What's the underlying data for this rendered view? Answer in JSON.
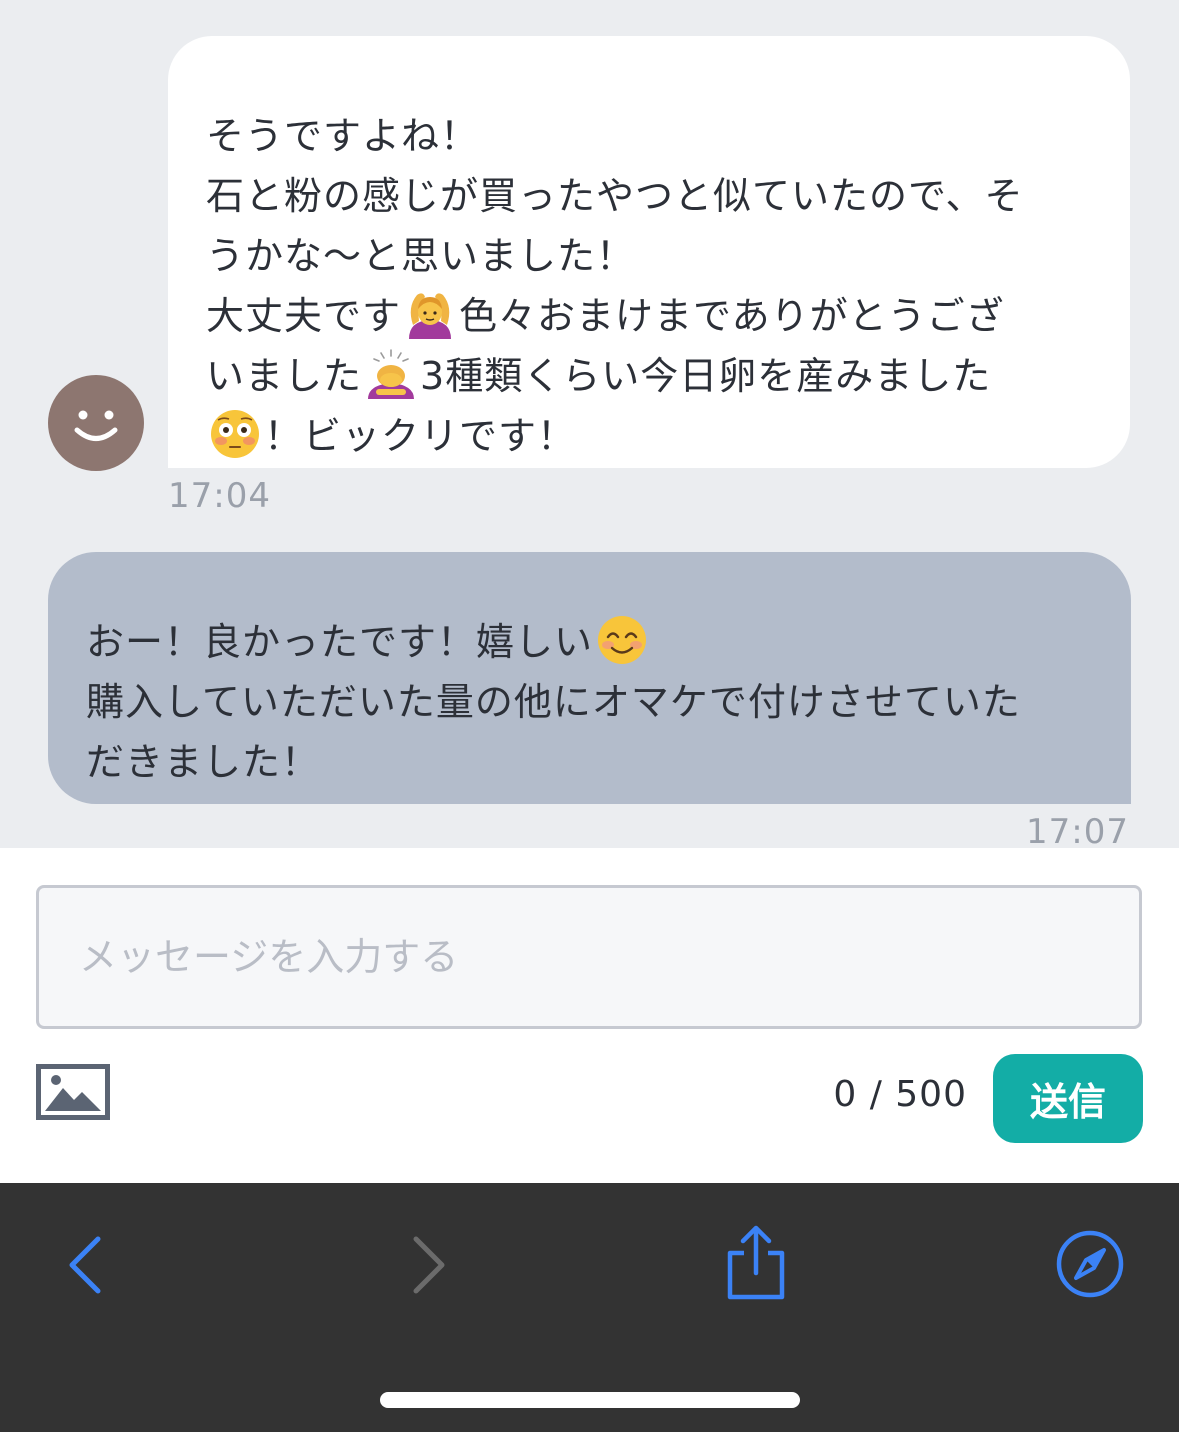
{
  "conversation": {
    "incoming": {
      "lines": [
        "そうですよね！",
        "石と粉の感じが買ったやつと似ていたので、そ",
        "うかな〜と思いました！",
        [
          "大丈夫です",
          "🙆‍♀️",
          "色々おまけまでありがとうござ"
        ],
        [
          "いました",
          "🙇‍♀️",
          "3種類くらい今日卵を産みました"
        ],
        [
          "😳",
          "！ビックリです！"
        ]
      ],
      "line1": "そうですよね！",
      "line2": "石と粉の感じが買ったやつと似ていたので、そ",
      "line3": "うかな〜と思いました！",
      "line4a": "大丈夫です",
      "line4b": "色々おまけまでありがとうござ",
      "line5a": "いました",
      "line5b": "3種類くらい今日卵を産みました",
      "line6": "！ビックリです！",
      "time": "17:04"
    },
    "outgoing": {
      "line1a": "おー！良かったです！嬉しい",
      "line2": "購入していただいた量の他にオマケで付けさせていた",
      "line3": "だきました！",
      "time": "17:07"
    }
  },
  "composer": {
    "placeholder": "メッセージを入力する",
    "value": "",
    "counter": "0 / 500",
    "send_label": "送信"
  },
  "icons": {
    "avatar": "smiley-avatar-icon",
    "image_attach": "image-icon",
    "emoji_gesture_ok": "woman-gesturing-ok-emoji",
    "emoji_bowing": "woman-bowing-emoji",
    "emoji_flushed": "flushed-face-emoji",
    "emoji_smile": "smiling-face-emoji",
    "back": "chevron-left-icon",
    "forward": "chevron-right-icon",
    "share": "share-icon",
    "safari": "compass-icon"
  },
  "colors": {
    "chat_background": "#ebedf0",
    "incoming_bubble": "#ffffff",
    "outgoing_bubble": "#b3bccb",
    "accent": "#13ada6",
    "avatar": "#8d7670",
    "browser_bar": "#333333",
    "nav_active": "#3b82f6",
    "nav_disabled": "#6b6b6b"
  }
}
